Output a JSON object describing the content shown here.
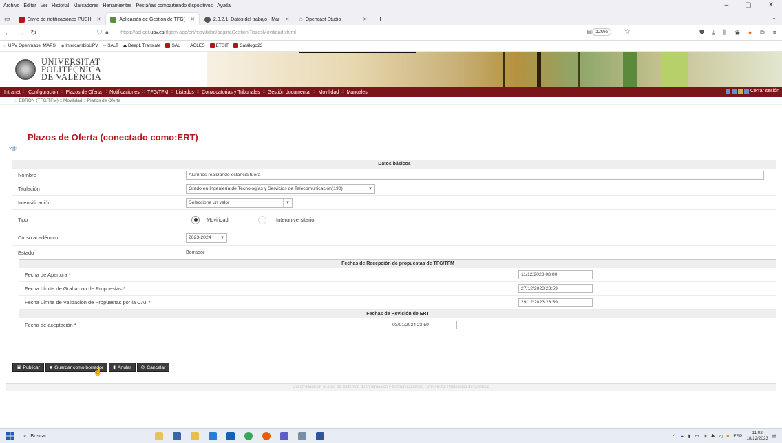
{
  "browser": {
    "menu": [
      "Archivo",
      "Editar",
      "Ver",
      "Historial",
      "Marcadores",
      "Herramientas",
      "Pestañas compartiendo dispositivos",
      "Ayuda"
    ],
    "window_controls": [
      "–",
      "▢",
      "✕"
    ],
    "tabs": [
      {
        "label": "Envio de notificaciones PUSH",
        "color": "#b0161c"
      },
      {
        "label": "Aplicación de Gestión de TFG(",
        "color": "#5a8f3a"
      },
      {
        "label": "2.3.2.1. Datos del trabajo - Mar",
        "color": "#555555"
      },
      {
        "label": "Opencast Studio",
        "color": "#4a6fa5"
      }
    ],
    "url_prefix": "https://aplicat.",
    "url_host": "upv.es",
    "url_path": "/tfgtfm-app/ert/movilidad/paginaGestionPlazosMovilidad.xhtml",
    "zoom": "120%",
    "bookmarks": [
      "UPV Openmaps: MAPS",
      "IntercambioUPV",
      "SALT",
      "DeepL Translate",
      "SAL",
      "ACLES",
      "ETSIT",
      "Catálogo23"
    ]
  },
  "header": {
    "university_line1": "UNIVERSITAT",
    "university_line2": "POLITÈCNICA",
    "university_line3": "DE VALÈNCIA"
  },
  "nav": {
    "items": [
      "Intranet",
      "Configuración",
      "Plazos de Oferta",
      "Notificaciones",
      "TFG/TFM",
      "Listados",
      "Convocatorias y Tribunales",
      "Gestión documental",
      "Movilidad",
      "Manuales"
    ],
    "logout": "Cerrar sesión",
    "breadcrumb": ":: EBRÓN (TFG/TFM) :: Movilidad :: Plazos de Oferta"
  },
  "page": {
    "title": "Plazos de Oferta (conectado como:ERT)",
    "help_icons": "?@"
  },
  "form": {
    "section_basic": "Datos básicos",
    "nombre_label": "Nombre",
    "nombre_value": "Alumnos realizando estancia fuera",
    "titulacion_label": "Titulación",
    "titulacion_value": "Grado en Ingeniería de Tecnologías y Servicios de Telecomunicación(190)",
    "intensificacion_label": "Intensificación",
    "intensificacion_value": "Seleccione un valor",
    "tipo_label": "Tipo",
    "tipo_opt1": "Movilidad",
    "tipo_opt2": "Interuniversitario",
    "curso_label": "Curso académico",
    "curso_value": "2023-2024",
    "estado_label": "Estado",
    "estado_value": "Borrador",
    "section_recepcion": "Fechas de Recepción de propuestas de TFG/TFM",
    "apertura_label": "Fecha de Apertura *",
    "apertura_value": "11/12/2023 08:00",
    "grabacion_label": "Fecha Límite de Grabación de Propuestas *",
    "grabacion_value": "27/12/2023 23:59",
    "validacion_label": "Fecha Límite de Validación de Propuestas por la CAT *",
    "validacion_value": "29/12/2023 23:59",
    "section_revision": "Fechas de Revisión de ERT",
    "aceptacion_label": "Fecha de aceptación *",
    "aceptacion_value": "03/01/2024 23:59"
  },
  "buttons": {
    "publicar": "Publicar",
    "guardar": "Guardar como borrador",
    "anular": "Anular",
    "cancelar": "Cancelar"
  },
  "footer": "Desarrollado en el área de Sistemas de Información y Comunicaciones - Universitat Politècnica de València",
  "taskbar": {
    "search": "Buscar",
    "lang": "ESP",
    "time": "11:02",
    "date": "18/12/2023"
  }
}
